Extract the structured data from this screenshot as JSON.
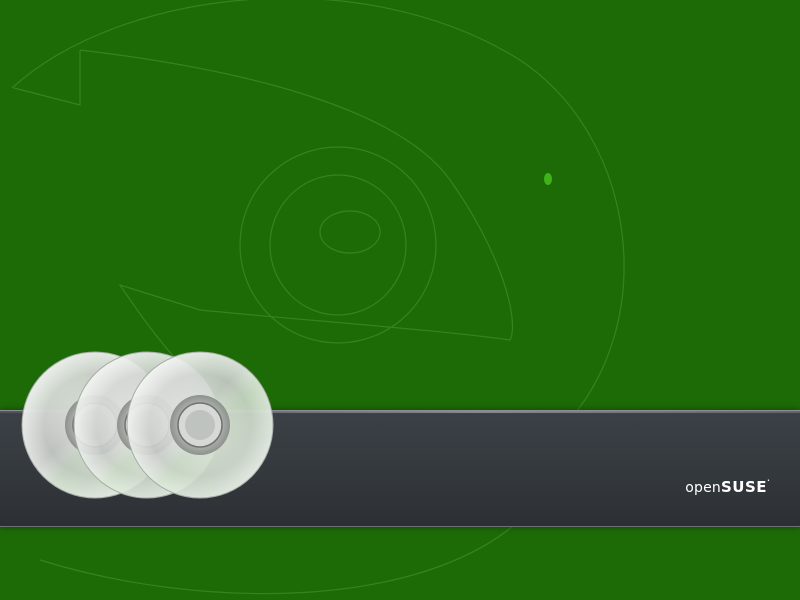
{
  "desktop": {
    "background_color": "#1d6b07",
    "art_line_color": "#3f8a2c",
    "accent_dot_color": "#3fb31a",
    "decor": "opensuse-geeko-outline"
  },
  "banner": {
    "color": "#363b40",
    "logo": {
      "prefix": "open",
      "name": "SUSE"
    }
  },
  "disc_icon": {
    "name": "cd-disc-icon",
    "count": 3
  }
}
